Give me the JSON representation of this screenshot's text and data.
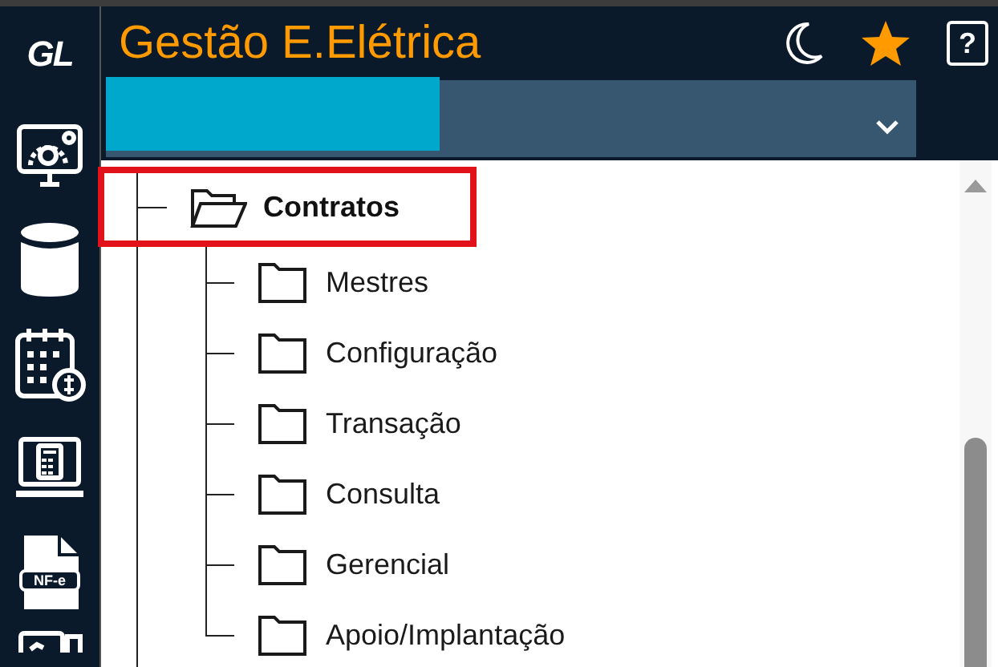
{
  "sidebar": {
    "logo": "GL",
    "items": [
      {
        "kind": "monitor"
      },
      {
        "kind": "database"
      },
      {
        "kind": "calendar"
      },
      {
        "kind": "laptop"
      },
      {
        "kind": "document",
        "label": "NF-e"
      },
      {
        "kind": "partial"
      }
    ]
  },
  "header": {
    "title": "Gestão E.Elétrica",
    "help": "?",
    "favorite": true
  },
  "tree": {
    "label": "Contratos",
    "expanded": true,
    "highlighted": true,
    "children": [
      {
        "label": "Mestres",
        "expanded": false
      },
      {
        "label": "Configuração",
        "expanded": false
      },
      {
        "label": "Transação",
        "expanded": false
      },
      {
        "label": "Consulta",
        "expanded": false
      },
      {
        "label": "Gerencial",
        "expanded": false
      },
      {
        "label": "Apoio/Implantação",
        "expanded": false
      }
    ]
  }
}
